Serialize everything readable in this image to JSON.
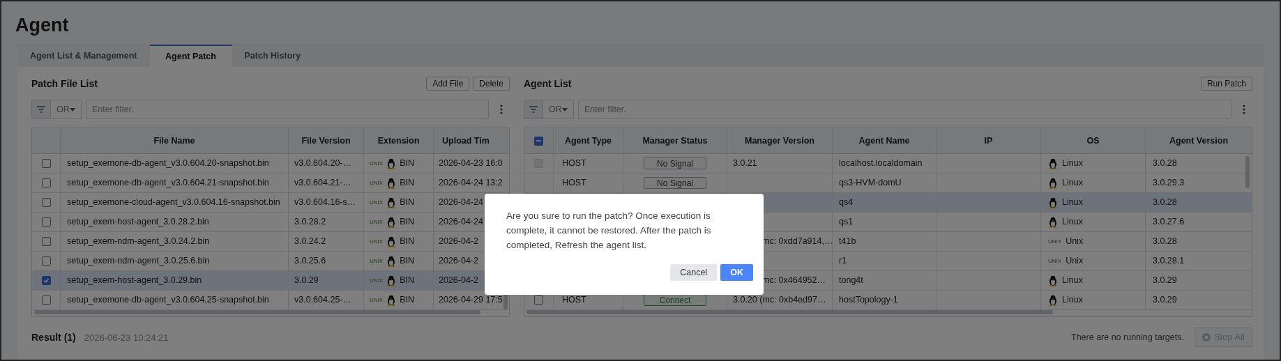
{
  "page_title": "Agent",
  "tabs": [
    {
      "label": "Agent List & Management",
      "selected": false
    },
    {
      "label": "Agent Patch",
      "selected": true
    },
    {
      "label": "Patch History",
      "selected": false
    }
  ],
  "patch_files": {
    "title": "Patch File List",
    "buttons": [
      "Add File",
      "Delete"
    ],
    "filter": {
      "operator": "OR",
      "placeholder": "Enter filter."
    },
    "columns": [
      "File Name",
      "File Version",
      "Extension",
      "Upload Tim"
    ],
    "rows": [
      {
        "checked": false,
        "selected": false,
        "file_name": "setup_exemone-db-agent_v3.0.604.20-snapshot.bin",
        "file_version": "v3.0.604.20-…",
        "ext_tag": "UNIX",
        "extension": "BIN",
        "upload_time": "2026-04-23 16:0"
      },
      {
        "checked": false,
        "selected": false,
        "file_name": "setup_exemone-db-agent_v3.0.604.21-snapshot.bin",
        "file_version": "v3.0.604.21-…",
        "ext_tag": "UNIX",
        "extension": "BIN",
        "upload_time": "2026-04-24 13:2"
      },
      {
        "checked": false,
        "selected": false,
        "file_name": "setup_exemone-cloud-agent_v3.0.604.16-snapshot.bin",
        "file_version": "v3.0.604.16-s…",
        "ext_tag": "UNIX",
        "extension": "BIN",
        "upload_time": "2026-04-24"
      },
      {
        "checked": false,
        "selected": false,
        "file_name": "setup_exem-host-agent_3.0.28.2.bin",
        "file_version": "3.0.28.2",
        "ext_tag": "UNIX",
        "extension": "BIN",
        "upload_time": "2026-04-24"
      },
      {
        "checked": false,
        "selected": false,
        "file_name": "setup_exem-ndm-agent_3.0.24.2.bin",
        "file_version": "3.0.24.2",
        "ext_tag": "UNIX",
        "extension": "BIN",
        "upload_time": "2026-04-2"
      },
      {
        "checked": false,
        "selected": false,
        "file_name": "setup_exem-ndm-agent_3.0.25.6.bin",
        "file_version": "3.0.25.6",
        "ext_tag": "UNIX",
        "extension": "BIN",
        "upload_time": "2026-04-2"
      },
      {
        "checked": true,
        "selected": true,
        "file_name": "setup_exem-host-agent_3.0.29.bin",
        "file_version": "3.0.29",
        "ext_tag": "UNIX",
        "extension": "BIN",
        "upload_time": "2026-04-2"
      },
      {
        "checked": false,
        "selected": false,
        "file_name": "setup_exemone-db-agent_v3.0.604.25-snapshot.bin",
        "file_version": "v3.0.604.25-…",
        "ext_tag": "UNIX",
        "extension": "BIN",
        "upload_time": "2026-04-29 17:5"
      }
    ]
  },
  "agents": {
    "title": "Agent List",
    "buttons": [
      "Run Patch"
    ],
    "filter": {
      "operator": "OR",
      "placeholder": "Enter filter."
    },
    "select_all": {
      "indeterminate": true
    },
    "columns": [
      "Agent Type",
      "Manager Status",
      "Manager Version",
      "Agent Name",
      "IP",
      "OS",
      "Agent Version"
    ],
    "rows": [
      {
        "selected": false,
        "checkbox": {
          "checked": false,
          "disabled": true
        },
        "agent_type": "HOST",
        "status": {
          "text": "No Signal",
          "kind": "idle"
        },
        "manager_version": "3.0.21",
        "agent_name": "localhost.localdomain",
        "os": {
          "kind": "linux",
          "label": "Linux"
        },
        "agent_version": "3.0.28"
      },
      {
        "selected": false,
        "agent_type": "HOST",
        "status": {
          "text": "No Signal",
          "kind": "idle"
        },
        "agent_name": "qs3-HVM-domU",
        "os": {
          "kind": "linux",
          "label": "Linux"
        },
        "agent_version": "3.0.29.3"
      },
      {
        "selected": true,
        "agent_name": "qs4",
        "os": {
          "kind": "linux",
          "label": "Linux"
        },
        "agent_version": "3.0.28"
      },
      {
        "selected": false,
        "agent_name": "qs1",
        "os": {
          "kind": "linux",
          "label": "Linux"
        },
        "agent_version": "3.0.27.6"
      },
      {
        "selected": false,
        "manager_version": "mc: 0xdd7a914,…",
        "agent_name": "t41b",
        "os": {
          "kind": "unix",
          "tag": "UNIX",
          "label": "Unix"
        },
        "agent_version": "3.0.28"
      },
      {
        "selected": false,
        "agent_name": "r1",
        "os": {
          "kind": "unix",
          "tag": "UNIX",
          "label": "Unix"
        },
        "agent_version": "3.0.28.1"
      },
      {
        "selected": false,
        "manager_version": "mc: 0x464952…",
        "agent_name": "tong4t",
        "os": {
          "kind": "linux",
          "label": "Linux"
        },
        "agent_version": "3.0.29"
      },
      {
        "selected": false,
        "checkbox": {
          "checked": false,
          "disabled": false
        },
        "agent_type": "HOST",
        "status": {
          "text": "Connect",
          "kind": "connected"
        },
        "manager_version": "3.0.20 (mc: 0xb4ed97…",
        "agent_name": "hostTopology-1",
        "os": {
          "kind": "linux",
          "label": "Linux"
        },
        "agent_version": "3.0.29"
      }
    ]
  },
  "result": {
    "title": "Result (1)",
    "timestamp": "2026-06-23 10:24:21",
    "message": "There are no running targets.",
    "stop_button": {
      "label": "Stop All",
      "disabled": true
    }
  },
  "dialog": {
    "message": "Are you sure to run the patch? Once execution is complete, it cannot be restored. After the patch is completed, Refresh the agent list.",
    "buttons": [
      {
        "label": "Cancel",
        "kind": "secondary"
      },
      {
        "label": "OK",
        "kind": "primary"
      }
    ]
  }
}
